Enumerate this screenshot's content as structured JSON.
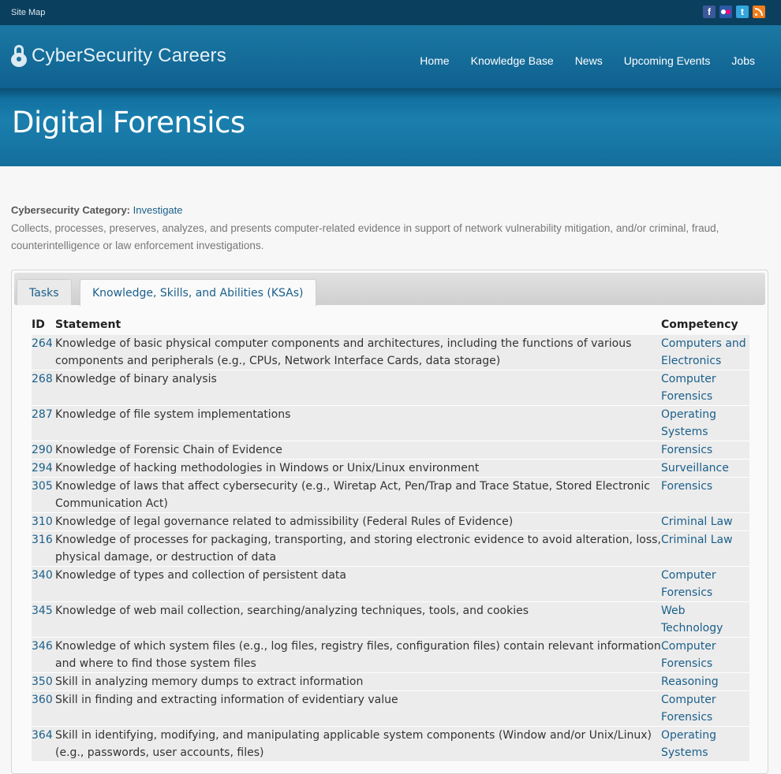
{
  "topbar": {
    "site_map": "Site Map",
    "social": [
      "facebook-icon",
      "flickr-icon",
      "twitter-icon",
      "rss-icon"
    ],
    "facebook_glyph": "f",
    "twitter_glyph": "t"
  },
  "header": {
    "logo_text": "CyberSecurity Careers",
    "nav": [
      "Home",
      "Knowledge Base",
      "News",
      "Upcoming Events",
      "Jobs"
    ]
  },
  "banner": {
    "title": "Digital Forensics"
  },
  "category": {
    "label": "Cybersecurity Category:",
    "value": "Investigate",
    "description": "Collects, processes, preserves, analyzes, and presents computer-related evidence in support of network vulnerability mitigation, and/or criminal, fraud, counterintelligence or law enforcement investigations."
  },
  "tabs": [
    {
      "label": "Tasks",
      "active": false
    },
    {
      "label": "Knowledge, Skills, and Abilities (KSAs)",
      "active": true
    }
  ],
  "table": {
    "headers": {
      "id": "ID",
      "statement": "Statement",
      "competency": "Competency"
    },
    "rows": [
      {
        "id": "264",
        "statement": "Knowledge of basic physical computer components and architectures, including the functions of various components and peripherals (e.g., CPUs, Network Interface Cards, data storage)",
        "competency": "Computers and Electronics"
      },
      {
        "id": "268",
        "statement": "Knowledge of binary analysis",
        "competency": "Computer Forensics"
      },
      {
        "id": "287",
        "statement": "Knowledge of file system implementations",
        "competency": "Operating Systems"
      },
      {
        "id": "290",
        "statement": "Knowledge of Forensic Chain of Evidence",
        "competency": "Forensics"
      },
      {
        "id": "294",
        "statement": "Knowledge of hacking methodologies in Windows or Unix/Linux environment",
        "competency": "Surveillance"
      },
      {
        "id": "305",
        "statement": "Knowledge of laws that affect cybersecurity (e.g., Wiretap Act, Pen/Trap and Trace Statue, Stored Electronic Communication Act)",
        "competency": "Forensics"
      },
      {
        "id": "310",
        "statement": "Knowledge of legal governance related to admissibility (Federal Rules of Evidence)",
        "competency": "Criminal Law"
      },
      {
        "id": "316",
        "statement": "Knowledge of processes for packaging, transporting, and storing electronic evidence to avoid alteration, loss, physical damage, or destruction of data",
        "competency": "Criminal Law"
      },
      {
        "id": "340",
        "statement": "Knowledge of types and collection of persistent data",
        "competency": "Computer Forensics"
      },
      {
        "id": "345",
        "statement": "Knowledge of web mail collection, searching/analyzing techniques, tools, and cookies",
        "competency": "Web Technology"
      },
      {
        "id": "346",
        "statement": "Knowledge of which system files (e.g., log files, registry files, configuration files) contain relevant information and where to find those system files",
        "competency": "Computer Forensics"
      },
      {
        "id": "350",
        "statement": "Skill in analyzing memory dumps to extract information",
        "competency": "Reasoning"
      },
      {
        "id": "360",
        "statement": "Skill in finding and extracting information of evidentiary value",
        "competency": "Computer Forensics"
      },
      {
        "id": "364",
        "statement": "Skill in identifying, modifying, and manipulating applicable system components (Window and/or Unix/Linux) (e.g., passwords, user accounts, files)",
        "competency": "Operating Systems"
      }
    ]
  }
}
